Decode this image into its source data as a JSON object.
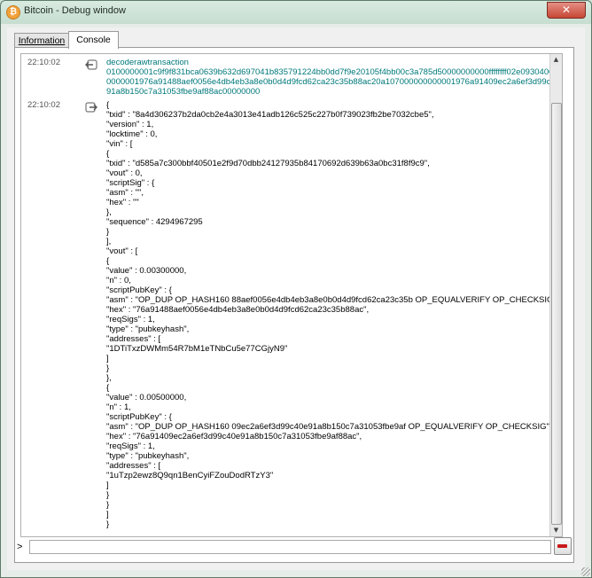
{
  "window": {
    "title": "Bitcoin - Debug window",
    "close_label": "✕"
  },
  "tabs": [
    {
      "label": "Information",
      "active": false
    },
    {
      "label": "Console",
      "active": true
    }
  ],
  "console": {
    "messages": [
      {
        "timestamp": "22:10:02",
        "kind": "command",
        "icon": "command-request-icon",
        "text": "decoderawtransaction\n0100000001c9f9f831bca0639b632d697041b835791224bb0dd7f9e20105f4bb00c3a785d50000000000ffffffff02e0930400000000001976a91488aef0056e4db4eb3a8e0b0d4d9fcd62ca23c35b88ac20a107000000000001976a91409ec2a6ef3d99c40e91a8b150c7a31053fbe9af88ac00000000"
      },
      {
        "timestamp": "22:10:02",
        "kind": "reply",
        "icon": "command-reply-icon",
        "text": "{\n\"txid\" : \"8a4d306237b2da0cb2e4a3013e41adb126c525c227b0f739023fb2be7032cbe5\",\n\"version\" : 1,\n\"locktime\" : 0,\n\"vin\" : [\n{\n\"txid\" : \"d585a7c300bbf40501e2f9d70dbb24127935b84170692d639b63a0bc31f8f9c9\",\n\"vout\" : 0,\n\"scriptSig\" : {\n\"asm\" : \"\",\n\"hex\" : \"\"\n},\n\"sequence\" : 4294967295\n}\n],\n\"vout\" : [\n{\n\"value\" : 0.00300000,\n\"n\" : 0,\n\"scriptPubKey\" : {\n\"asm\" : \"OP_DUP OP_HASH160 88aef0056e4db4eb3a8e0b0d4d9fcd62ca23c35b OP_EQUALVERIFY OP_CHECKSIG\",\n\"hex\" : \"76a91488aef0056e4db4eb3a8e0b0d4d9fcd62ca23c35b88ac\",\n\"reqSigs\" : 1,\n\"type\" : \"pubkeyhash\",\n\"addresses\" : [\n\"1DTiTxzDWMm54R7bM1eTNbCu5e77CGjyN9\"\n]\n}\n},\n{\n\"value\" : 0.00500000,\n\"n\" : 1,\n\"scriptPubKey\" : {\n\"asm\" : \"OP_DUP OP_HASH160 09ec2a6ef3d99c40e91a8b150c7a31053fbe9af OP_EQUALVERIFY OP_CHECKSIG\",\n\"hex\" : \"76a91409ec2a6ef3d99c40e91a8b150c7a31053fbe9af88ac\",\n\"reqSigs\" : 1,\n\"type\" : \"pubkeyhash\",\n\"addresses\" : [\n\"1uTzp2ewz8Q9qn1BenCyiFZouDodRTzY3\"\n]\n}\n}\n]\n}"
      }
    ],
    "prompt": ">",
    "input_value": "",
    "input_placeholder": "",
    "clear_icon": "clear-console-icon"
  },
  "colors": {
    "command_text": "#00787a",
    "reply_text": "#000000",
    "timestamp": "#555555"
  }
}
